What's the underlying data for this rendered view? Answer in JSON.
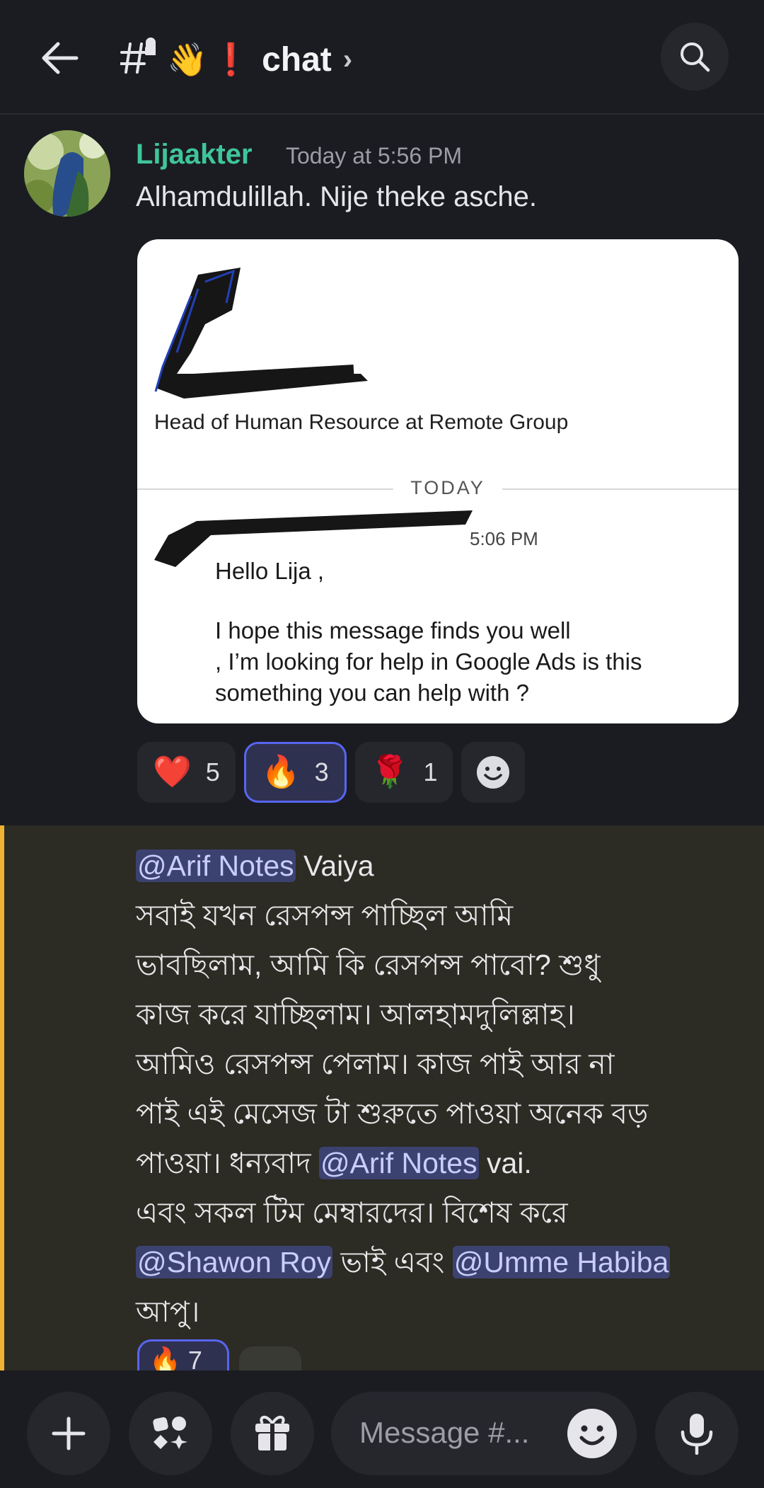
{
  "header": {
    "channel_emoji": "👋",
    "channel_mark": "❗",
    "channel_name": "chat",
    "chevron": "›"
  },
  "message1": {
    "username": "Lijaakter",
    "timestamp": "Today at 5:56 PM",
    "text": "Alhamdulillah. Nije theke asche.",
    "attachment": {
      "role": "Head of Human Resource at Remote Group",
      "divider_label": "TODAY",
      "time": "5:06 PM",
      "lines": [
        "Hello Lija ,",
        "",
        "I hope this message finds you well",
        ", I’m looking for help in Google Ads is this",
        "something you can help with ?"
      ]
    },
    "reactions": [
      {
        "emoji": "❤️",
        "count": "5",
        "active": false
      },
      {
        "emoji": "🔥",
        "count": "3",
        "active": true
      },
      {
        "emoji": "🌹",
        "count": "1",
        "active": false
      }
    ]
  },
  "message2": {
    "mention_arif": "@Arif Notes",
    "mention_shawon": "@Shawon Roy",
    "mention_umme": "@Umme Habiba",
    "line1_rest": " Vaiya",
    "line2": "সবাই যখন রেসপন্স পাচ্ছিল আমি",
    "line3": "ভাবছিলাম, আমি কি রেসপন্স পাবো? শুধু",
    "line4": "কাজ করে যাচ্ছিলাম। আলহামদুলিল্লাহ।",
    "line5": "আমিও রেসপন্স পেলাম। কাজ পাই আর না",
    "line6": "পাই এই মেসেজ টা শুরুতে পাওয়া অনেক বড়",
    "line7_start": "পাওয়া। ধন্যবাদ ",
    "line7_end": " vai.",
    "line8": "এবং সকল টিম মেম্বারদের। বিশেষ করে",
    "line9_mid": " ভাই এবং ",
    "line10": "আপু।",
    "reaction_partial": "🔥 7"
  },
  "composer": {
    "placeholder": "Message #..."
  },
  "colors": {
    "background": "#1b1c21",
    "username": "#3fc59a",
    "mention_bg": "#3c4270",
    "highlight_bar": "#f0b232",
    "accent": "#5865f2"
  }
}
